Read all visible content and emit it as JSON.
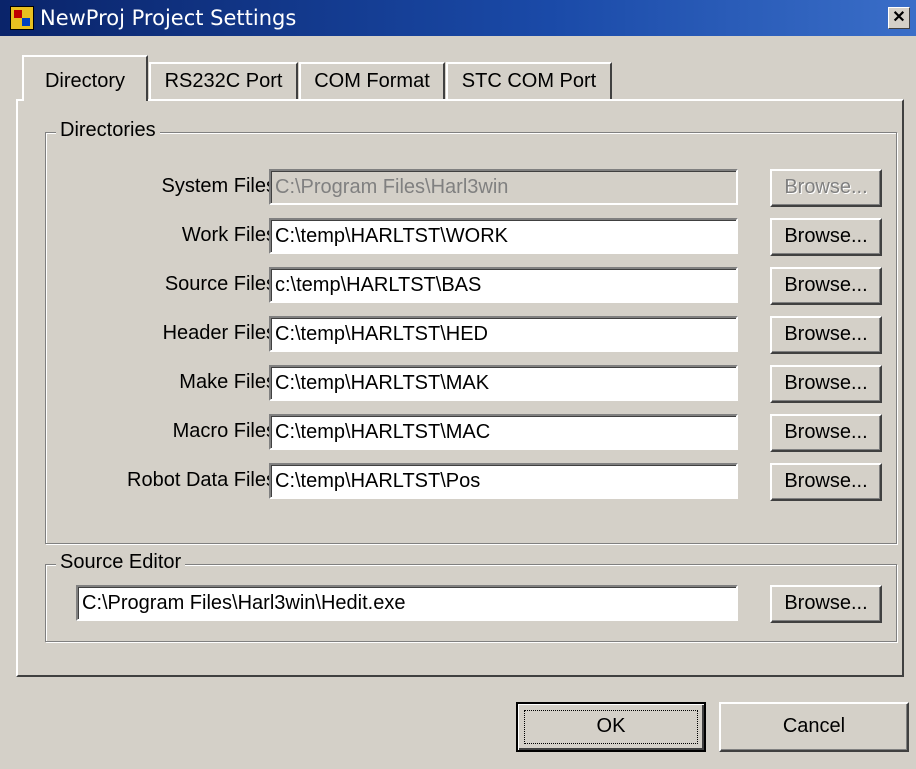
{
  "window": {
    "title": "NewProj Project Settings",
    "close_glyph": "✕"
  },
  "tabs": [
    {
      "label": "Directory",
      "active": true
    },
    {
      "label": "RS232C Port",
      "active": false
    },
    {
      "label": "COM Format",
      "active": false
    },
    {
      "label": "STC COM Port",
      "active": false
    }
  ],
  "directories": {
    "group_label": "Directories",
    "rows": [
      {
        "label": "System Files",
        "value": "C:\\Program Files\\Harl3win",
        "enabled": false,
        "browse": "Browse..."
      },
      {
        "label": "Work Files",
        "value": "C:\\temp\\HARLTST\\WORK",
        "enabled": true,
        "browse": "Browse..."
      },
      {
        "label": "Source Files",
        "value": "c:\\temp\\HARLTST\\BAS",
        "enabled": true,
        "browse": "Browse..."
      },
      {
        "label": "Header Files",
        "value": "C:\\temp\\HARLTST\\HED",
        "enabled": true,
        "browse": "Browse..."
      },
      {
        "label": "Make Files",
        "value": "C:\\temp\\HARLTST\\MAK",
        "enabled": true,
        "browse": "Browse..."
      },
      {
        "label": "Macro Files",
        "value": "C:\\temp\\HARLTST\\MAC",
        "enabled": true,
        "browse": "Browse..."
      },
      {
        "label": "Robot Data Files",
        "value": "C:\\temp\\HARLTST\\Pos",
        "enabled": true,
        "browse": "Browse..."
      }
    ]
  },
  "source_editor": {
    "group_label": "Source Editor",
    "value": "C:\\Program Files\\Harl3win\\Hedit.exe",
    "browse": "Browse..."
  },
  "footer": {
    "ok_label": "OK",
    "cancel_label": "Cancel"
  },
  "colors": {
    "title_bar": "#0a246a",
    "face": "#d4d0c8",
    "field": "#ffffff",
    "disabled_text": "#808080"
  }
}
